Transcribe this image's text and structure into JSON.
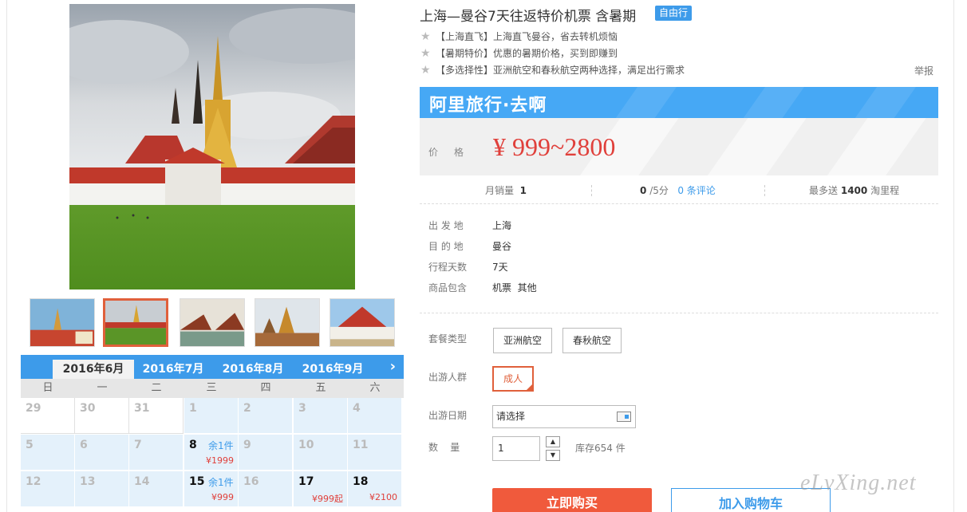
{
  "product": {
    "title": "上海—曼谷7天往返特价机票 含暑期",
    "tag": "自由行",
    "features": [
      "【上海直飞】上海直飞曼谷，省去转机烦恼",
      "【暑期特价】优惠的暑期价格，买到即赚到",
      "【多选择性】亚洲航空和春秋航空两种选择，满足出行需求"
    ],
    "report_label": "举报"
  },
  "brand": {
    "name": "阿里旅行·去啊"
  },
  "price": {
    "label": "价格",
    "value": "¥ 999~2800"
  },
  "stats": {
    "monthly_sales_label": "月销量",
    "monthly_sales_value": "1",
    "rating_value": "0",
    "rating_suffix": "/5分",
    "reviews": "0 条评论",
    "points_prefix": "最多送",
    "points_value": "1400",
    "points_suffix": "淘里程"
  },
  "details": [
    {
      "label": "出 发 地",
      "value": "上海"
    },
    {
      "label": "目 的 地",
      "value": "曼谷"
    },
    {
      "label": "行程天数",
      "value": "7天"
    },
    {
      "label": "商品包含",
      "value": "机票  其他"
    }
  ],
  "options": {
    "package_label": "套餐类型",
    "packages": [
      "亚洲航空",
      "春秋航空"
    ],
    "traveler_label": "出游人群",
    "traveler": "成人",
    "date_label": "出游日期",
    "date_value": "请选择",
    "qty_label": "数    量",
    "qty_value": "1",
    "qty_up": "▲",
    "qty_down": "▼",
    "stock": "库存654 件"
  },
  "actions": {
    "buy": "立即购买",
    "cart": "加入购物车"
  },
  "calendar": {
    "months": [
      "2016年6月",
      "2016年7月",
      "2016年8月",
      "2016年9月"
    ],
    "active_month": 0,
    "next_arrow": "›",
    "weekdays": [
      "日",
      "一",
      "二",
      "三",
      "四",
      "五",
      "六"
    ],
    "rows": [
      [
        {
          "day": "29",
          "white": true
        },
        {
          "day": "30",
          "white": true
        },
        {
          "day": "31",
          "white": true
        },
        {
          "day": "1"
        },
        {
          "day": "2"
        },
        {
          "day": "3"
        },
        {
          "day": "4"
        }
      ],
      [
        {
          "day": "5"
        },
        {
          "day": "6"
        },
        {
          "day": "7"
        },
        {
          "day": "8",
          "active": true,
          "stock": "余1件",
          "price": "¥1999"
        },
        {
          "day": "9"
        },
        {
          "day": "10"
        },
        {
          "day": "11"
        }
      ],
      [
        {
          "day": "12"
        },
        {
          "day": "13"
        },
        {
          "day": "14"
        },
        {
          "day": "15",
          "active": true,
          "stock": "余1件",
          "price": "¥999"
        },
        {
          "day": "16"
        },
        {
          "day": "17",
          "active": true,
          "price": "¥999起"
        },
        {
          "day": "18",
          "active": true,
          "price": "¥2100"
        }
      ]
    ]
  },
  "watermark": "eLvXing.net",
  "colors": {
    "accent": "#3d9bea",
    "price": "#e0403b",
    "buy": "#f05a3c",
    "selected": "#e0603b"
  }
}
